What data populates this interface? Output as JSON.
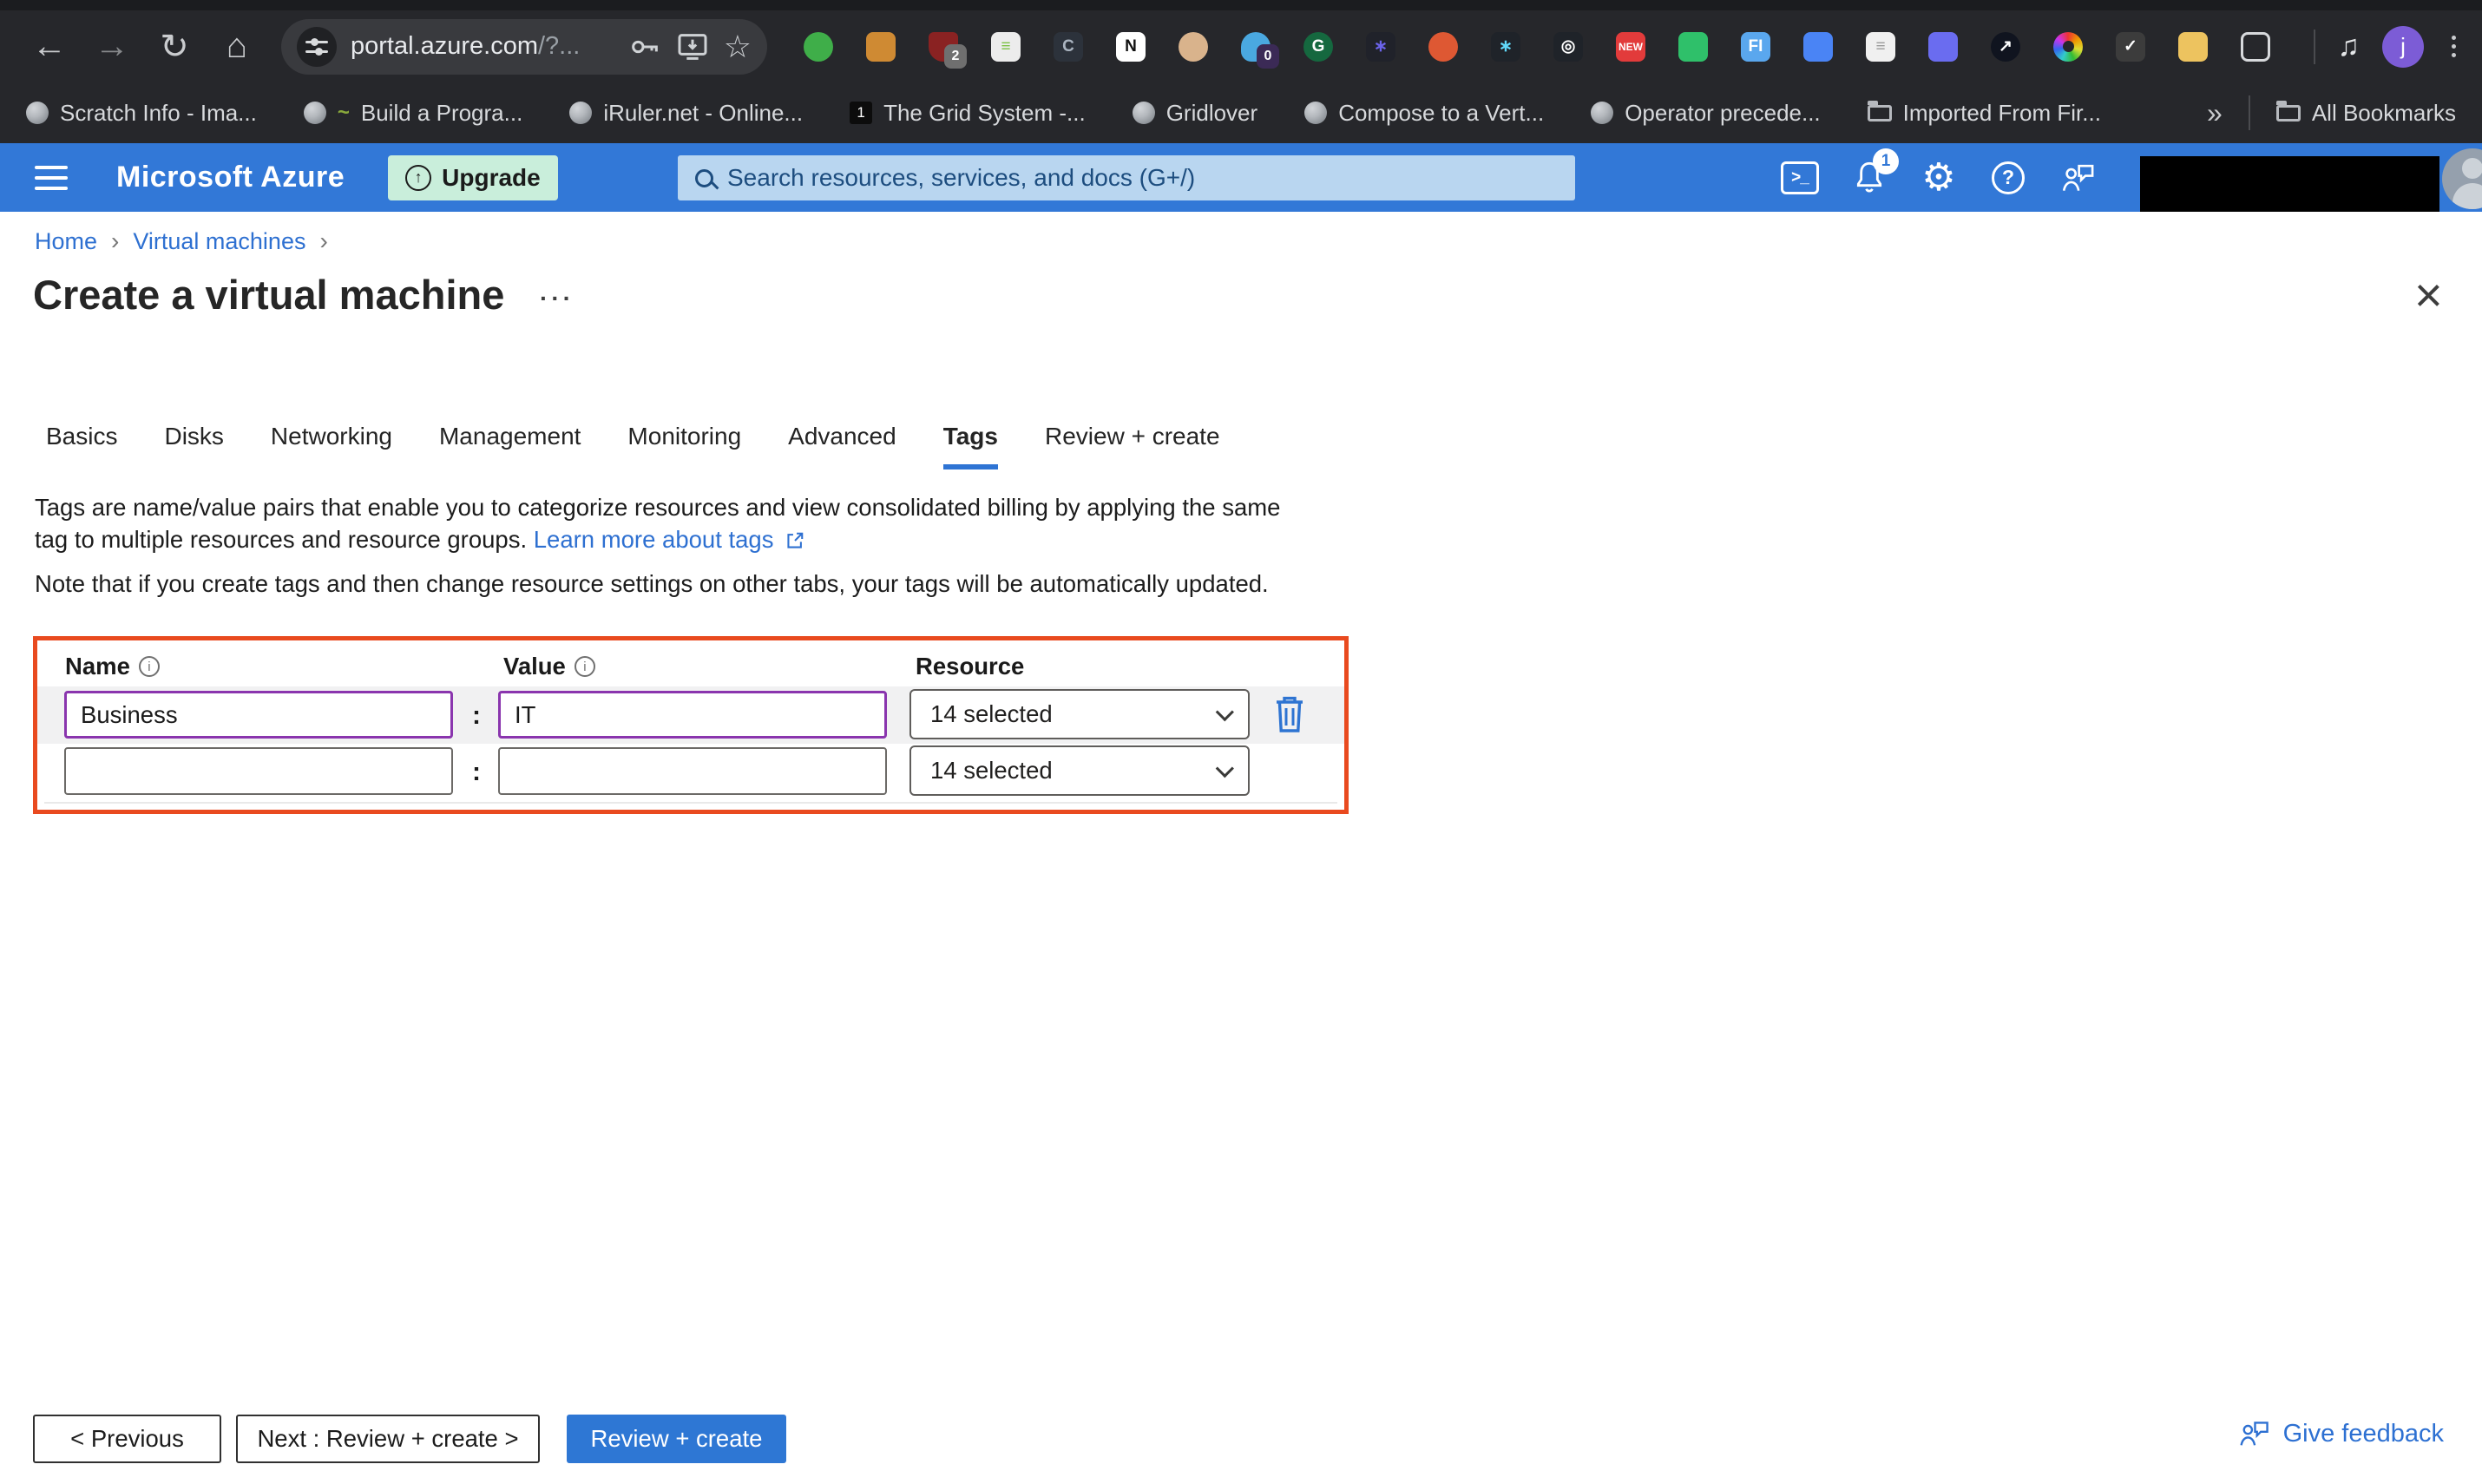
{
  "browser": {
    "url_domain": "portal.azure.com",
    "url_path": "/?...",
    "profile_initial": "j",
    "extensions": [
      {
        "name": "evernote",
        "bg": "#3fae49",
        "glyph": "",
        "shape": "circle"
      },
      {
        "name": "ocaml-book",
        "bg": "#cf8a33",
        "glyph": ""
      },
      {
        "name": "ublock",
        "bg": "#8a2222",
        "glyph": "",
        "shape": "shield",
        "badge": "2",
        "badge_bg": "#6f6f6f"
      },
      {
        "name": "notes-list",
        "bg": "#ececec",
        "glyph": "≡",
        "fg": "#7ac143"
      },
      {
        "name": "clockify",
        "bg": "#2c323b",
        "glyph": "C",
        "fg": "#aab4c0"
      },
      {
        "name": "notion",
        "bg": "#ffffff",
        "glyph": "N",
        "fg": "#111111"
      },
      {
        "name": "persona-face",
        "bg": "#d9b38c",
        "glyph": "",
        "shape": "circle"
      },
      {
        "name": "ghostery",
        "bg": "#4aa8e0",
        "glyph": "",
        "shape": "ghost",
        "badge": "0",
        "badge_bg": "#3b2a56"
      },
      {
        "name": "grammarly",
        "bg": "#15683f",
        "glyph": "G",
        "fg": "#ffffff",
        "shape": "circle"
      },
      {
        "name": "asterisk",
        "bg": "#20222a",
        "glyph": "∗",
        "fg": "#6b63ea"
      },
      {
        "name": "duckduckgo",
        "bg": "#de5833",
        "glyph": "",
        "shape": "circle"
      },
      {
        "name": "react",
        "bg": "#1f2329",
        "glyph": "∗",
        "fg": "#61dafb"
      },
      {
        "name": "target-rings",
        "bg": "#1f2329",
        "glyph": "◎",
        "fg": "#ffffff"
      },
      {
        "name": "new-badge",
        "bg": "#e23b3b",
        "glyph": "NEW",
        "fg": "#ffffff"
      },
      {
        "name": "green-figure",
        "bg": "#2fc06a",
        "glyph": ""
      },
      {
        "name": "fonts-ninja",
        "bg": "#5aa7ee",
        "glyph": "FI",
        "fg": "#ffffff"
      },
      {
        "name": "phone",
        "bg": "#4a84f5",
        "glyph": ""
      },
      {
        "name": "document",
        "bg": "#f0f0f0",
        "glyph": "≡",
        "fg": "#9a9a9a"
      },
      {
        "name": "grid",
        "bg": "#6a6cf0",
        "glyph": ""
      },
      {
        "name": "dark-arrow",
        "bg": "#10141f",
        "glyph": "↗",
        "fg": "#ffffff",
        "shape": "circle"
      },
      {
        "name": "colorzilla",
        "bg": "rainbow",
        "glyph": "",
        "shape": "rainbow"
      },
      {
        "name": "todo-check",
        "bg": "#3c3c3c",
        "glyph": "✓",
        "fg": "#ffffff"
      },
      {
        "name": "yellow-folder",
        "bg": "#edc35f",
        "glyph": ""
      },
      {
        "name": "extensions-puzzle",
        "bg": "outline",
        "glyph": "",
        "shape": "outline"
      }
    ],
    "bookmarks": [
      {
        "label": "Scratch Info - Ima...",
        "icon": "globe"
      },
      {
        "label": "Build a Progra...",
        "icon": "snake"
      },
      {
        "label": "iRuler.net - Online...",
        "icon": "globe"
      },
      {
        "label": "The Grid System -...",
        "icon": "one"
      },
      {
        "label": "Gridlover",
        "icon": "globe"
      },
      {
        "label": "Compose to a Vert...",
        "icon": "globe"
      },
      {
        "label": "Operator precede...",
        "icon": "globe"
      },
      {
        "label": "Imported From Fir...",
        "icon": "folder"
      }
    ],
    "bookmarks_overflow": "»",
    "all_bookmarks_label": "All Bookmarks"
  },
  "azure_header": {
    "brand": "Microsoft Azure",
    "upgrade_label": "Upgrade",
    "upgrade_arrow": "↑",
    "search_placeholder": "Search resources, services, and docs (G+/)",
    "cloud_shell_glyph": ">_",
    "notification_badge": "1",
    "gear_glyph": "⚙",
    "help_glyph": "?"
  },
  "breadcrumb": {
    "items": [
      "Home",
      "Virtual machines"
    ],
    "separator": "›"
  },
  "page": {
    "title": "Create a virtual machine",
    "title_ellipsis": "···",
    "close_glyph": "×"
  },
  "tabs": {
    "items": [
      "Basics",
      "Disks",
      "Networking",
      "Management",
      "Monitoring",
      "Advanced",
      "Tags",
      "Review + create"
    ],
    "active": "Tags"
  },
  "description": {
    "intro": "Tags are name/value pairs that enable you to categorize resources and view consolidated billing by applying the same tag to multiple resources and resource groups.",
    "link_label": "Learn more about tags",
    "note": "Note that if you create tags and then change resource settings on other tabs, your tags will be automatically updated."
  },
  "tag_table": {
    "columns": [
      "Name",
      "Value",
      "Resource"
    ],
    "info_glyph": "i",
    "colon": ":",
    "rows": [
      {
        "name": "Business",
        "value": "IT",
        "resource": "14 selected"
      },
      {
        "name": "",
        "value": "",
        "resource": "14 selected"
      }
    ]
  },
  "footer": {
    "previous_label": "< Previous",
    "next_label": "Next : Review + create >",
    "review_label": "Review + create",
    "feedback_label": "Give feedback"
  },
  "colors": {
    "azure_blue": "#3278d7",
    "accent_link": "#2e70d1",
    "highlight_border": "#e94a1f",
    "focused_input_border": "#8a35ae",
    "upgrade_bg": "#c9eedb"
  }
}
